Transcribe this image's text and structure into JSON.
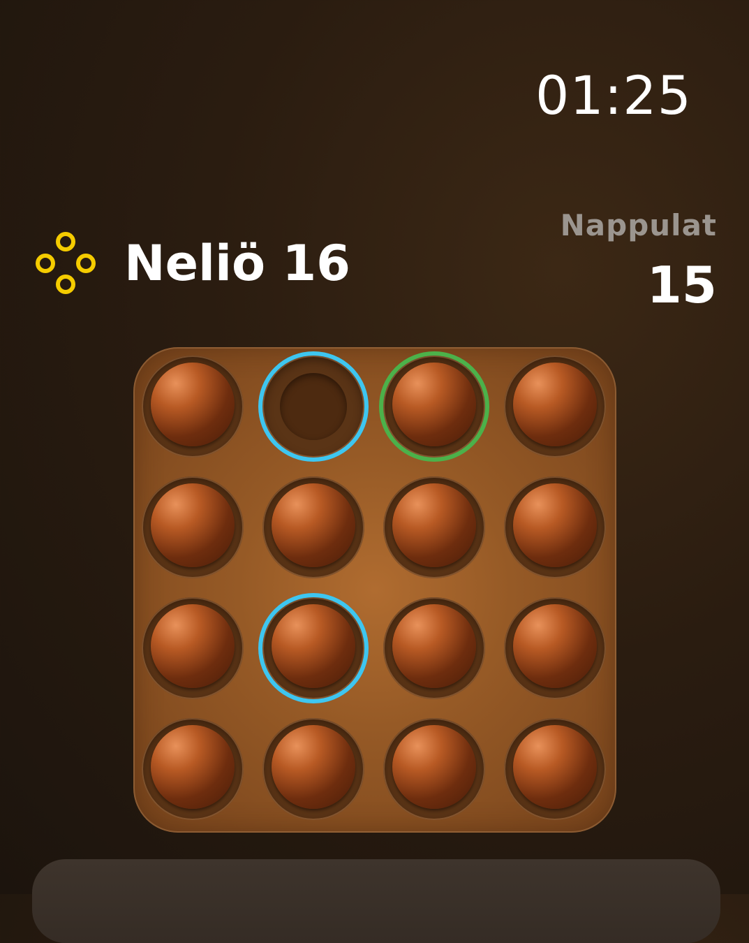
{
  "status": {
    "time": "01:25"
  },
  "header": {
    "title": "Neliö 16",
    "icon": "four-rings-icon",
    "icon_color": "#f5cc00"
  },
  "stats": {
    "pieces_label": "Nappulat",
    "pieces_value": "15"
  },
  "board": {
    "rows": 4,
    "cols": 4,
    "cells": [
      [
        "peg",
        "empty",
        "peg",
        "peg"
      ],
      [
        "peg",
        "peg",
        "peg",
        "peg"
      ],
      [
        "peg",
        "peg",
        "peg",
        "peg"
      ],
      [
        "peg",
        "peg",
        "peg",
        "peg"
      ]
    ],
    "highlights": [
      {
        "row": 0,
        "col": 1,
        "color": "cyan"
      },
      {
        "row": 0,
        "col": 2,
        "color": "green"
      },
      {
        "row": 2,
        "col": 1,
        "color": "cyan"
      }
    ]
  }
}
